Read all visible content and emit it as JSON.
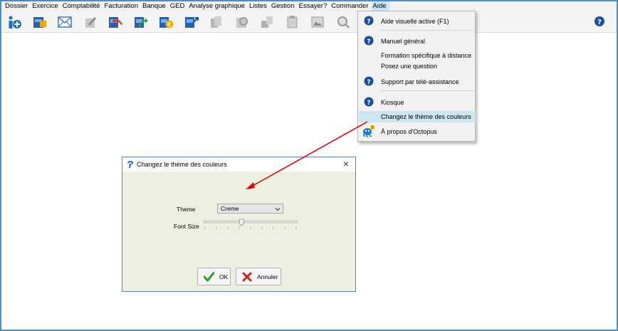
{
  "menubar": {
    "items": [
      "Dossier",
      "Exercice",
      "Comptabilité",
      "Facturation",
      "Banque",
      "GED",
      "Analyse graphique",
      "Listes",
      "Gestion",
      "Essayer?",
      "Commander",
      "Aide"
    ]
  },
  "toolbar": {
    "icons": [
      "info-add-icon",
      "calendar-blue-icon",
      "envelope-icon",
      "edit-doc-icon",
      "puzzle-back-icon",
      "puzzle-forward-icon",
      "puzzle-euro-icon",
      "puzzle-plus-icon",
      "copy-gray-icon",
      "link-gray-icon",
      "paste-gray-icon",
      "clipboard-gray-icon",
      "image-doc-icon",
      "zoom-doc-icon",
      "gray-doc-icon"
    ],
    "help_icon": "question-circle-icon"
  },
  "dropdown": {
    "items": [
      {
        "label": "Aide visuelle active (F1)",
        "icon": "question-circle-icon"
      },
      {
        "label": "Manuel général",
        "icon": "question-circle-icon"
      },
      {
        "label": "Formation spécifique à distance",
        "icon": ""
      },
      {
        "label": "Posez une question",
        "icon": ""
      },
      {
        "label": "Support par télé-assistance",
        "icon": "question-circle-icon"
      },
      {
        "label": "Kiosque",
        "icon": "question-circle-icon"
      },
      {
        "label": "Changez le thème des couleurs",
        "icon": ""
      },
      {
        "label": "À propos d'Octopus",
        "icon": "octopus-icon"
      }
    ]
  },
  "dialog": {
    "title": "Changez le thème des couleurs",
    "theme_label": "Theme",
    "theme_value": "Creme",
    "font_size_label": "Font Size",
    "font_size_level": 0.4,
    "ok_label": "OK",
    "cancel_label": "Annuler"
  },
  "colors": {
    "accent": "#4a90c8",
    "dialog_bg": "#edf0e0",
    "arrow": "#e00000",
    "highlight": "#cde8f0"
  }
}
